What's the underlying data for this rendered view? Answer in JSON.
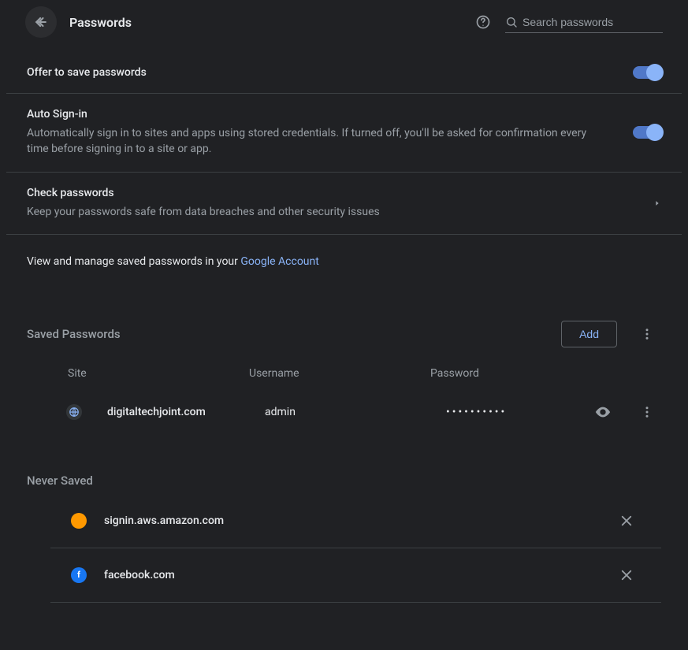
{
  "header": {
    "title": "Passwords",
    "search_placeholder": "Search passwords"
  },
  "settings": {
    "offer_save": {
      "title": "Offer to save passwords"
    },
    "auto_signin": {
      "title": "Auto Sign-in",
      "subtitle": "Automatically sign in to sites and apps using stored credentials. If turned off, you'll be asked for confirmation every time before signing in to a site or app."
    },
    "check_passwords": {
      "title": "Check passwords",
      "subtitle": "Keep your passwords safe from data breaches and other security issues"
    },
    "manage": {
      "prefix": "View and manage saved passwords in your ",
      "link": "Google Account"
    }
  },
  "saved": {
    "heading": "Saved Passwords",
    "add_label": "Add",
    "columns": {
      "site": "Site",
      "username": "Username",
      "password": "Password"
    },
    "rows": [
      {
        "site": "digitaltechjoint.com",
        "username": "admin",
        "password": "••••••••••"
      }
    ]
  },
  "never": {
    "heading": "Never Saved",
    "rows": [
      {
        "site": "signin.aws.amazon.com",
        "icon": "aws"
      },
      {
        "site": "facebook.com",
        "icon": "fb"
      }
    ]
  }
}
